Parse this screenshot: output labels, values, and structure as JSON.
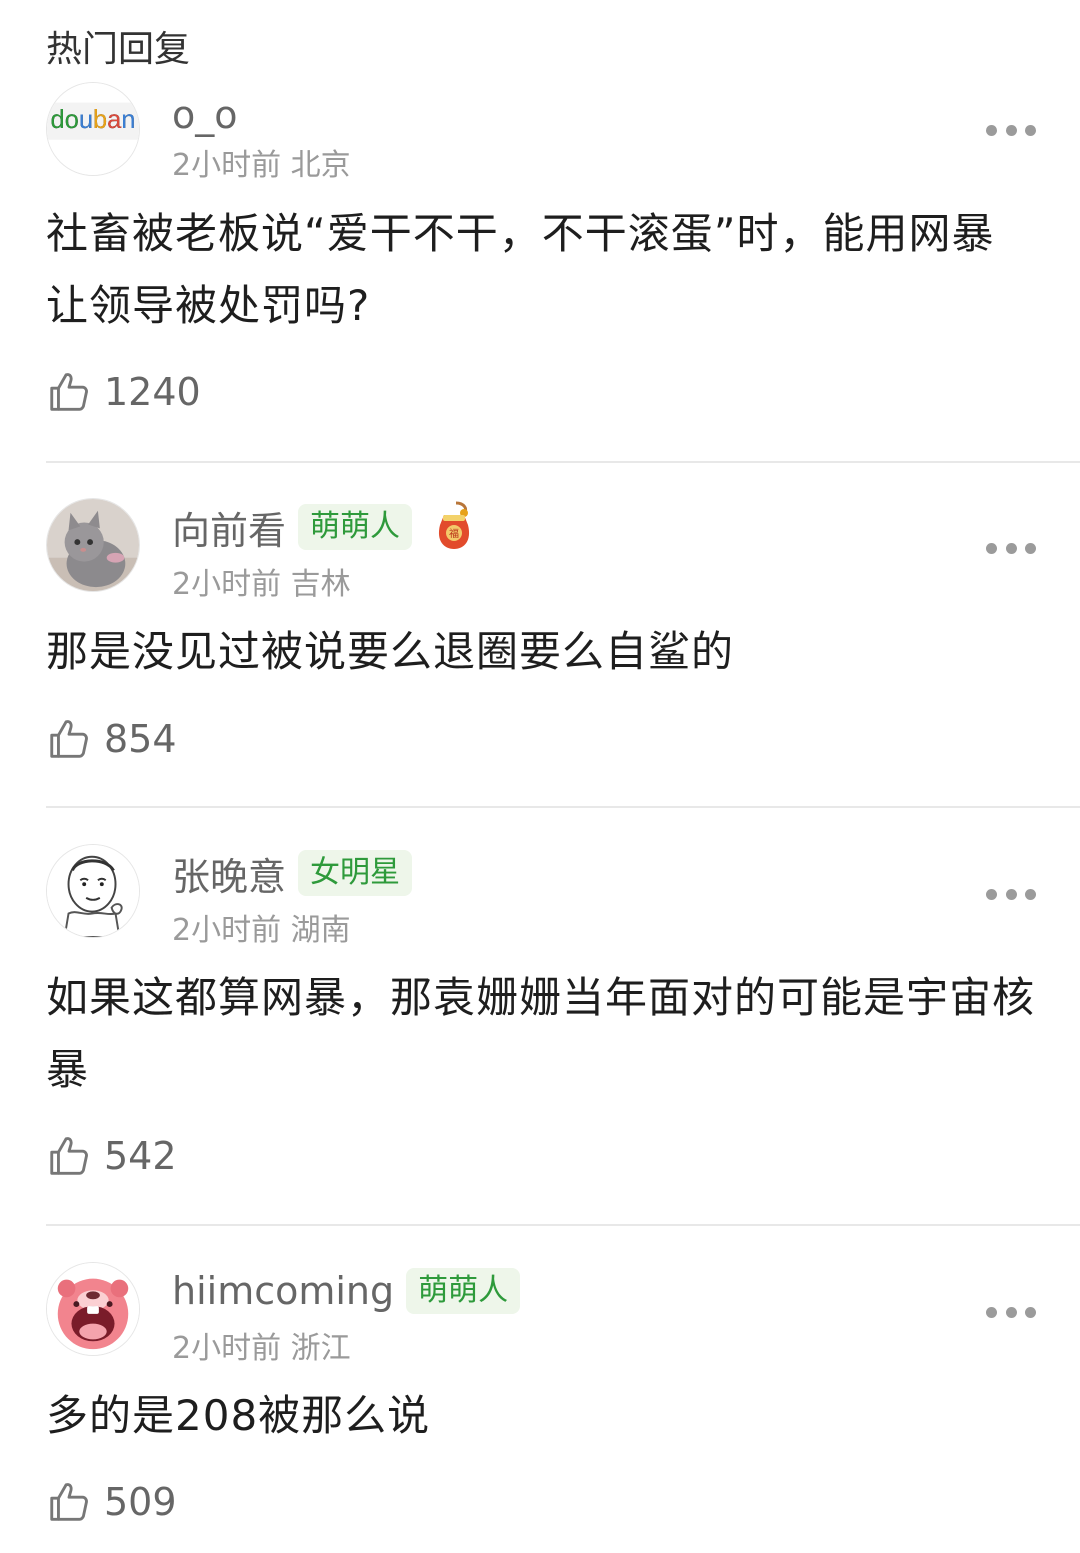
{
  "header": {
    "title": "热门回复"
  },
  "comments": [
    {
      "username": "o_o",
      "avatar": "douban-logo-avatar",
      "avatar_text": "douban",
      "badge": "",
      "time": "2小时前",
      "location": "北京",
      "text": "社畜被老板说“爱干不干，不干滚蛋”时，能用网暴让领导被处罚吗?",
      "likes": "1240"
    },
    {
      "username": "向前看",
      "avatar": "gray-kitten-avatar",
      "badge": "萌萌人",
      "medal": "red-pouch-medal-icon",
      "time": "2小时前",
      "location": "吉林",
      "text": "那是没见过被说要么退圈要么自鲨的",
      "likes": "854"
    },
    {
      "username": "张晚意",
      "avatar": "meme-face-sketch-avatar",
      "badge": "女明星",
      "time": "2小时前",
      "location": "湖南",
      "text": "如果这都算网暴，那袁姗姗当年面对的可能是宇宙核暴",
      "likes": "542"
    },
    {
      "username": "hiimcoming",
      "avatar": "pink-cartoon-beaver-avatar",
      "badge": "萌萌人",
      "time": "2小时前",
      "location": "浙江",
      "text": "多的是208被那么说",
      "likes": "509"
    }
  ],
  "icons": {
    "like": "thumbs-up-icon",
    "more": "more-dots-icon"
  },
  "colors": {
    "badge_bg": "#eef6ea",
    "badge_text": "#2e9a3b",
    "meta_text": "#9a9a9a",
    "divider": "#e8e8e8"
  }
}
